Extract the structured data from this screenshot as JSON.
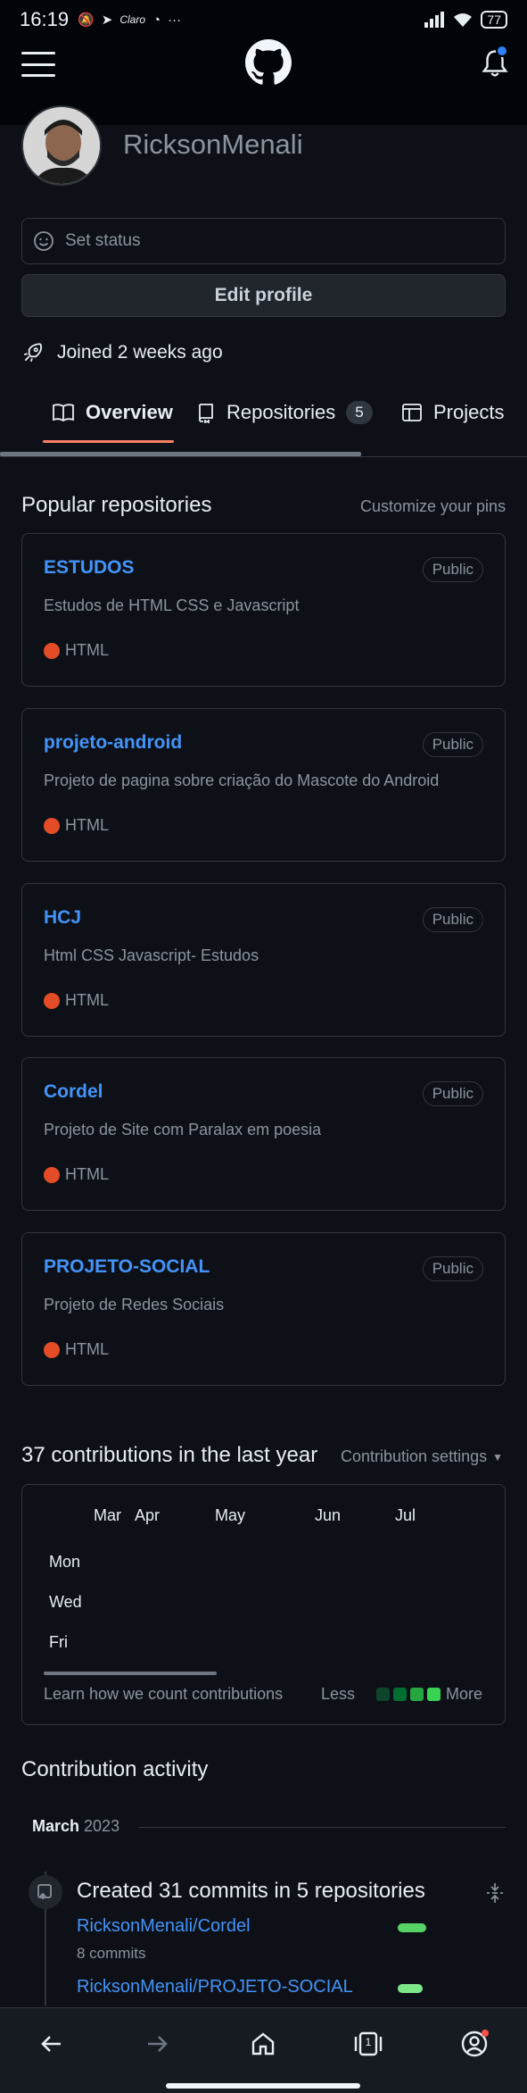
{
  "status_bar": {
    "time": "16:19",
    "carrier": "Claro",
    "dots": "···",
    "battery": "77"
  },
  "header": {
    "menu_icon": "hamburger-icon",
    "logo_icon": "github-octocat-icon",
    "notifications_icon": "bell-icon",
    "accent_color": "#2f81f7"
  },
  "profile": {
    "username": "RicksonMenali",
    "set_status_label": "Set status",
    "edit_profile_label": "Edit profile",
    "joined_text": "Joined 2 weeks ago"
  },
  "tabs": [
    {
      "label": "Overview",
      "icon": "book-icon",
      "active": true
    },
    {
      "label": "Repositories",
      "icon": "repo-icon",
      "count": "5"
    },
    {
      "label": "Projects",
      "icon": "table-icon"
    }
  ],
  "popular": {
    "title": "Popular repositories",
    "customize_label": "Customize your pins",
    "repos": [
      {
        "name": "ESTUDOS",
        "visibility": "Public",
        "description": "Estudos de HTML CSS e Javascript",
        "language": "HTML",
        "language_color": "#e34c26"
      },
      {
        "name": "projeto-android",
        "visibility": "Public",
        "description": "Projeto de pagina sobre criação do Mascote do Android",
        "language": "HTML",
        "language_color": "#e34c26"
      },
      {
        "name": "HCJ",
        "visibility": "Public",
        "description": "Html CSS Javascript- Estudos",
        "language": "HTML",
        "language_color": "#e34c26"
      },
      {
        "name": "Cordel",
        "visibility": "Public",
        "description": "Projeto de Site com Paralax em poesia",
        "language": "HTML",
        "language_color": "#e34c26"
      },
      {
        "name": "PROJETO-SOCIAL",
        "visibility": "Public",
        "description": "Projeto de Redes Sociais",
        "language": "HTML",
        "language_color": "#e34c26"
      }
    ]
  },
  "contributions": {
    "title": "37 contributions in the last year",
    "settings_label": "Contribution settings",
    "months": [
      "Mar",
      "Apr",
      "May",
      "Jun",
      "Jul"
    ],
    "days": [
      "Mon",
      "Wed",
      "Fri"
    ],
    "learn_label": "Learn how we count contributions",
    "legend_less": "Less",
    "legend_more": "More",
    "legend_colors": [
      "#0e4429",
      "#006d32",
      "#26a641",
      "#39d353"
    ]
  },
  "activity": {
    "title": "Contribution activity",
    "month": "March",
    "year": "2023",
    "summary": "Created 31 commits in 5 repositories",
    "items": [
      {
        "repo": "RicksonMenali/Cordel",
        "commits": "8 commits",
        "share": 1.0
      },
      {
        "repo": "RicksonMenali/PROJETO-SOCIAL",
        "share": 0.9
      }
    ]
  },
  "bottom_nav": {
    "items": [
      "back-arrow-icon",
      "forward-arrow-icon",
      "home-icon",
      "tabs-icon",
      "profile-icon"
    ],
    "tabs_count": "1"
  }
}
